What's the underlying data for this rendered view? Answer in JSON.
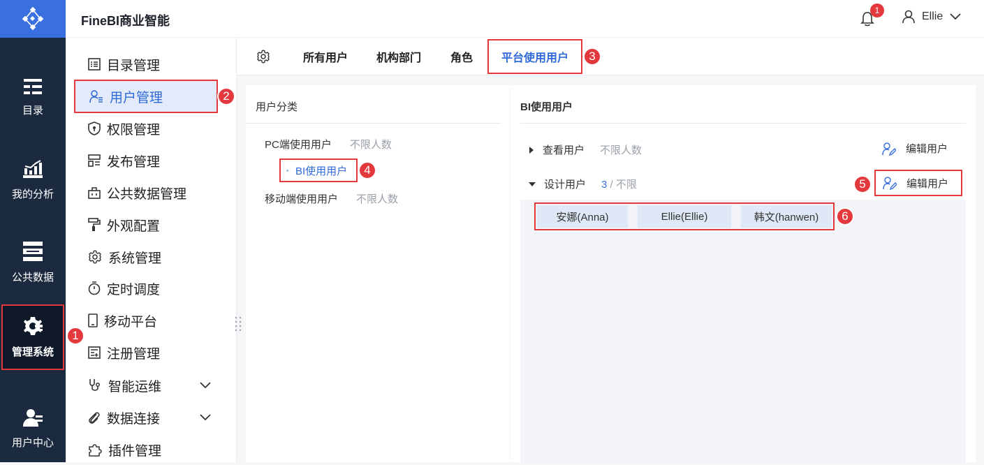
{
  "app": {
    "title": "FineBI商业智能"
  },
  "header": {
    "notification_count": "1",
    "user_name": "Ellie"
  },
  "rail": {
    "items": [
      {
        "label": "目录",
        "icon": "catalog-icon"
      },
      {
        "label": "我的分析",
        "icon": "analysis-icon"
      },
      {
        "label": "公共数据",
        "icon": "database-icon"
      },
      {
        "label": "管理系统",
        "icon": "gear-icon",
        "active": true
      },
      {
        "label": "用户中心",
        "icon": "user-center-icon"
      }
    ]
  },
  "submenu": {
    "items": [
      {
        "label": "目录管理"
      },
      {
        "label": "用户管理",
        "active": true
      },
      {
        "label": "权限管理"
      },
      {
        "label": "发布管理"
      },
      {
        "label": "公共数据管理"
      },
      {
        "label": "外观配置"
      },
      {
        "label": "系统管理"
      },
      {
        "label": "定时调度"
      },
      {
        "label": "移动平台"
      },
      {
        "label": "注册管理"
      },
      {
        "label": "智能运维",
        "expandable": true
      },
      {
        "label": "数据连接",
        "expandable": true
      },
      {
        "label": "插件管理"
      }
    ]
  },
  "tabs": [
    {
      "label": "所有用户"
    },
    {
      "label": "机构部门"
    },
    {
      "label": "角色"
    },
    {
      "label": "平台使用用户",
      "active": true
    }
  ],
  "category_panel": {
    "title": "用户分类",
    "pc": {
      "label": "PC端使用用户",
      "limit": "不限人数"
    },
    "bi": {
      "label": "BI使用用户"
    },
    "mobile": {
      "label": "移动端使用用户",
      "limit": "不限人数"
    }
  },
  "bi_panel": {
    "title": "BI使用用户",
    "view_group": {
      "label": "查看用户",
      "limit": "不限人数",
      "edit_label": "编辑用户"
    },
    "design_group": {
      "label": "设计用户",
      "count": "3",
      "separator": " / ",
      "limit": "不限",
      "edit_label": "编辑用户"
    },
    "users": [
      "安娜(Anna)",
      "Ellie(Ellie)",
      "韩文(hanwen)"
    ]
  },
  "callouts": [
    "1",
    "2",
    "3",
    "4",
    "5",
    "6"
  ],
  "colors": {
    "accent": "#2f6bd8",
    "highlight": "#e4393c",
    "rail": "#1c2a3f"
  }
}
